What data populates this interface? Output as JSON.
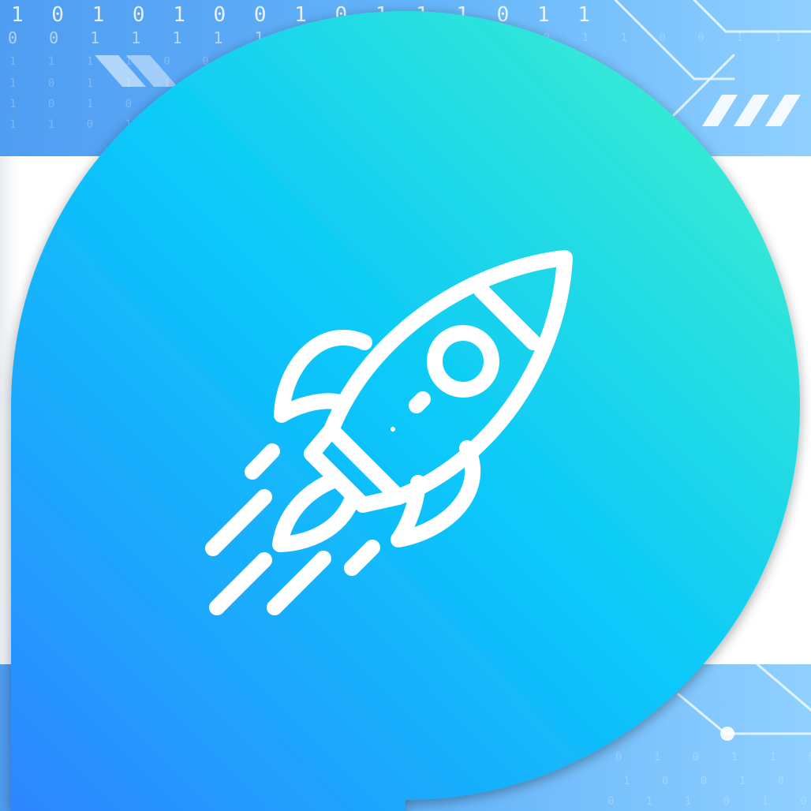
{
  "background": {
    "binary_rows": [
      {
        "text": "1 0 1 0 1 0 0 1 0 1 1 1 0 1 1",
        "style": "big"
      },
      {
        "text": "0 0 1 1 1 1 1 0 0 0 1",
        "style": "normal"
      },
      {
        "text": "1 1 1 1 0 0 0 0 1 0",
        "style": "faint"
      },
      {
        "text": "1 0 1 1 1 1 0 1",
        "style": "faint"
      },
      {
        "text": "1 0 1 0 0 0 1 0",
        "style": "faint"
      },
      {
        "text": "1 1 0 1 0 1 0 0",
        "style": "faint"
      }
    ],
    "binary_rows_bottom": [
      {
        "text": "0 1 0 1 1 0 0 1 0 1",
        "style": "faint"
      },
      {
        "text": "1 0 0 1 0 1 1 0 1",
        "style": "faint"
      },
      {
        "text": "0 1 1 0 1 0 0 1 1",
        "style": "faint"
      }
    ],
    "top_right_binary": "1 0 1 1 0 0 1 1 1 0 0 1",
    "colors": {
      "band": "#5aa8f5",
      "panel": "#ffffff"
    }
  },
  "icon": {
    "name": "rocket-icon",
    "color": "#ffffff"
  },
  "badge": {
    "gradient_start": "#2f86ff",
    "gradient_mid": "#0ac8fa",
    "gradient_end": "#44f5c8"
  }
}
